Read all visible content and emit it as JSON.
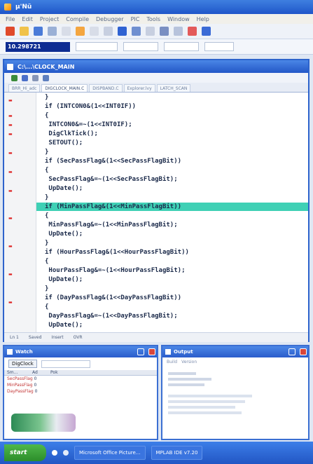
{
  "window": {
    "title": "µ'Nü"
  },
  "menu": [
    "File",
    "Edit",
    "Project",
    "Compile",
    "Debugger",
    "PIC",
    "Tools",
    "Window",
    "Help"
  ],
  "address": {
    "value": "10.298721"
  },
  "editor": {
    "title": "C:\\...\\CLOCK_MAIN",
    "tabs": [
      "BRR_Hi_adc",
      "DIGCLOCK_MAIN.C",
      "DISPBAND.C",
      "Explorer.lvy",
      "LATCH_SCAN"
    ],
    "code_lines": [
      "}",
      "if (INTCON0&(1<<INT0IF))",
      "{",
      " INTCON0&=~(1<<INT0IF);",
      " DigClkTick();",
      " SETOUT();",
      "}",
      "if (SecPassFlag&(1<<SecPassFlagBit))",
      "{",
      " SecPassFlag&=~(1<<SecPassFlagBit);",
      " UpDate();",
      "}",
      "if (MinPassFlag&(1<<MinPassFlagBit))",
      "{",
      " MinPassFlag&=~(1<<MinPassFlagBit);",
      " UpDate();",
      "}",
      "if (HourPassFlag&(1<<HourPassFlagBit))",
      "{",
      " HourPassFlag&=~(1<<HourPassFlagBit);",
      " UpDate();",
      "}",
      "if (DayPassFlag&(1<<DayPassFlagBit))",
      "{",
      " DayPassFlag&=~(1<<DayPassFlagBit);",
      " UpDate();"
    ],
    "status": {
      "line": "Ln 1",
      "col": "Saved",
      "mode": "Insert",
      "ovr": "OVR"
    }
  },
  "watch": {
    "title": "Watch",
    "button": "DigClock",
    "headers": [
      "Sm...",
      "Ad",
      "Pok"
    ],
    "rows": [
      {
        "name": "SecPassFlag",
        "value": "0"
      },
      {
        "name": "MinPassFlag",
        "value": "0"
      },
      {
        "name": "DayPassFlag",
        "value": "0"
      }
    ]
  },
  "output": {
    "title": "Output",
    "tabs": [
      "Build",
      "Version"
    ]
  },
  "taskbar": {
    "start": "start",
    "items": [
      "Microsoft Office Picture...",
      "MPLAB IDE v7.20"
    ]
  },
  "colors": {
    "titlebar": "#2a60d0",
    "highlight": "#3fd0b5",
    "address": "#0e2c92"
  }
}
